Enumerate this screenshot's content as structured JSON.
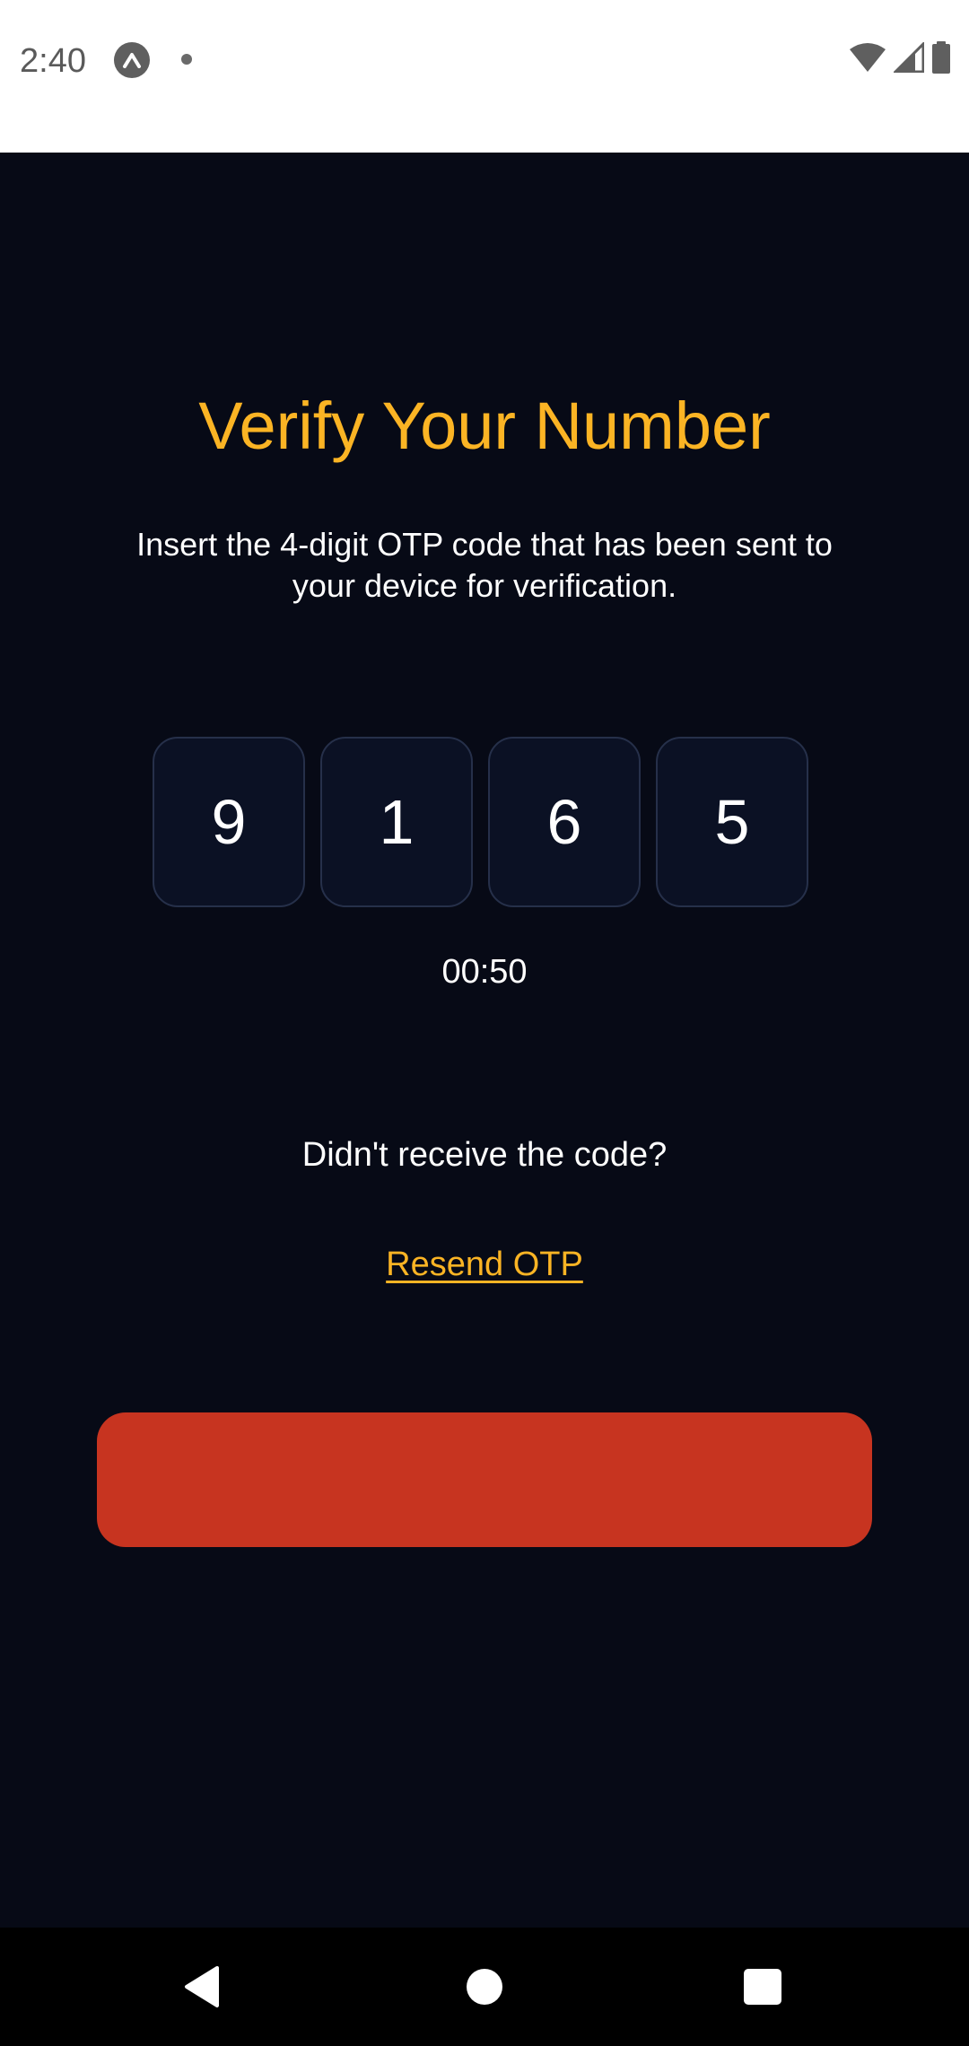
{
  "status_bar": {
    "time": "2:40",
    "icons": [
      "app-notification-icon",
      "dot-icon",
      "wifi-icon",
      "cellular-signal-icon",
      "battery-icon"
    ]
  },
  "screen": {
    "title": "Verify Your Number",
    "subtitle": "Insert the 4-digit OTP code that has been sent to your device for verification.",
    "otp_digits": [
      "9",
      "1",
      "6",
      "5"
    ],
    "timer": "00:50",
    "didnt_receive": "Didn't receive the code?",
    "resend_label": "Resend OTP",
    "verify_button_label": ""
  },
  "colors": {
    "background": "#070a16",
    "accent": "#fbb424",
    "button": "#c73420",
    "otp_box": "#0b1124",
    "otp_border": "#26304a"
  },
  "nav_bar": {
    "icons": [
      "back-icon",
      "home-icon",
      "recents-icon"
    ]
  }
}
